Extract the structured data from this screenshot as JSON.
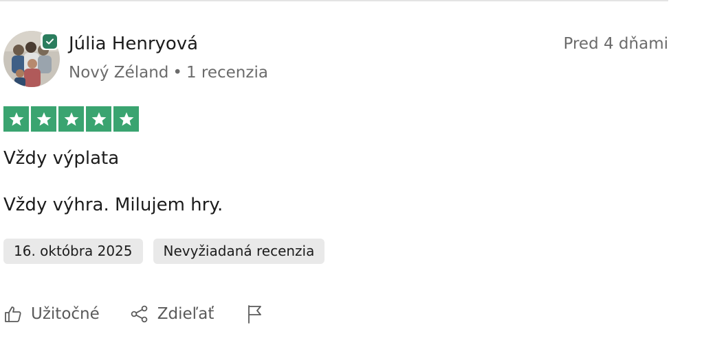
{
  "reviewer": {
    "name": "Júlia Henryová",
    "country": "Nový Zéland",
    "separator": "•",
    "review_count": "1 recenzia",
    "verified": true
  },
  "review": {
    "relative_date": "Pred 4 dňami",
    "rating": 5,
    "rating_max": 5,
    "title": "Vždy výplata",
    "body": "Vždy výhra. Milujem hry.",
    "tags": [
      "16. októbra 2025",
      "Nevyžiadaná recenzia"
    ]
  },
  "actions": {
    "helpful_label": "Užitočné",
    "share_label": "Zdieľať"
  },
  "icons": {
    "verified": "check-badge-icon",
    "star": "star-icon",
    "helpful": "thumbs-up-icon",
    "share": "share-icon",
    "report": "flag-icon"
  },
  "colors": {
    "star_green": "#3aa470",
    "badge_green": "#2b7d5e",
    "secondary_text": "#6b6b6b",
    "tag_background": "#e9e9e9"
  }
}
